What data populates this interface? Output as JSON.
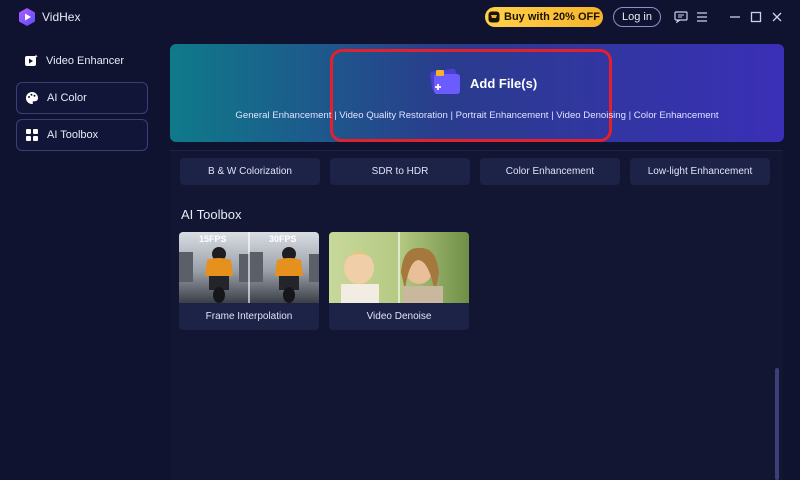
{
  "app": {
    "name": "VidHex"
  },
  "header": {
    "promo_label": "Buy with 20% OFF",
    "login_label": "Log in"
  },
  "sidebar": {
    "items": [
      {
        "label": "Video Enhancer",
        "icon": "video-enhancer-icon"
      },
      {
        "label": "AI Color",
        "icon": "palette-icon"
      },
      {
        "label": "AI Toolbox",
        "icon": "toolbox-icon"
      }
    ]
  },
  "hero": {
    "add_label": "Add File(s)",
    "subtitle": "General Enhancement | Video Quality Restoration | Portrait Enhancement | Video Denoising | Color Enhancement"
  },
  "chips": [
    "B & W Colorization",
    "SDR to HDR",
    "Color Enhancement",
    "Low-light Enhancement"
  ],
  "toolbox": {
    "title": "AI Toolbox",
    "cards": [
      {
        "label": "Frame Interpolation",
        "badges": [
          "15FPS",
          "30FPS"
        ]
      },
      {
        "label": "Video Denoise"
      }
    ]
  },
  "colors": {
    "background": "#0f1330",
    "promo": "#f6b42c",
    "highlight": "#e3202b",
    "accent": "#5b4bff"
  }
}
